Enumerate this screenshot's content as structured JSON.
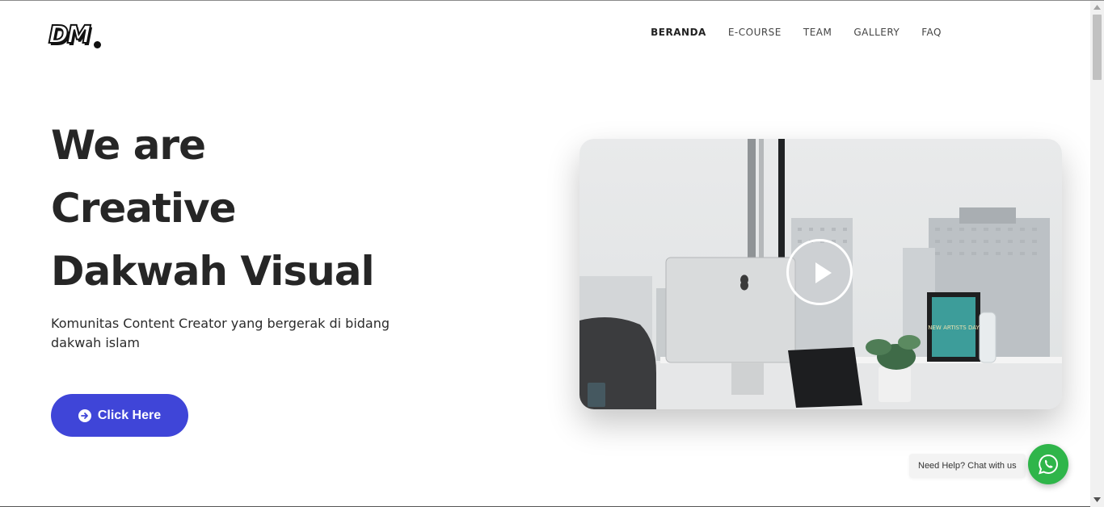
{
  "brand": {
    "logo_text": "DM"
  },
  "nav": {
    "items": [
      {
        "label": "BERANDA",
        "active": true
      },
      {
        "label": "E-COURSE",
        "active": false
      },
      {
        "label": "TEAM",
        "active": false
      },
      {
        "label": "GALLERY",
        "active": false
      },
      {
        "label": "FAQ",
        "active": false
      }
    ]
  },
  "hero": {
    "title_lines": [
      "We are",
      "Creative",
      "Dakwah Visual"
    ],
    "subtitle": "Komunitas Content Creator yang bergerak di bidang dakwah islam",
    "cta_label": "Click Here",
    "cta_icon": "arrow-circle-right-icon",
    "accent_color": "#3f45d8"
  },
  "video": {
    "play_icon": "play-icon",
    "poster_sign_text": "NEW ARTISTS DAY"
  },
  "chat": {
    "label": "Need Help? Chat with us",
    "icon": "whatsapp-icon",
    "color": "#2fb54a"
  }
}
